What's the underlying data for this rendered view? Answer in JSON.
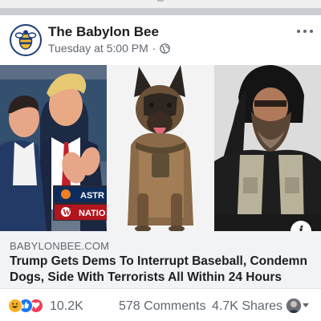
{
  "post": {
    "page_name": "The Babylon Bee",
    "timestamp": "Tuesday at 5:00 PM",
    "privacy_separator": "·",
    "privacy_icon": "globe-icon",
    "menu_icon": "more-options-icon"
  },
  "image": {
    "panels": [
      {
        "description_icon": "photo-politicians-panel",
        "scoreboard": [
          "ASTR",
          "NATIO"
        ]
      },
      {
        "description_icon": "photo-dog-panel"
      },
      {
        "description_icon": "photo-bearded-man-panel"
      }
    ],
    "info_label": "i"
  },
  "link": {
    "domain": "BABYLONBEE.COM",
    "headline": "Trump Gets Dems To Interrupt Baseball, Condemn Dogs, Side With Terrorists All Within 24 Hours"
  },
  "engagement": {
    "reaction_icons": [
      "haha-reaction-icon",
      "like-reaction-icon",
      "love-reaction-icon"
    ],
    "reaction_count": "10.2K",
    "comments": "578 Comments",
    "shares": "4.7K Shares"
  },
  "colors": {
    "like": "#1877f2",
    "love": "#f33e58",
    "haha": "#f7b125",
    "logo_ring": "#1c3f7a",
    "logo_yellow": "#f5b82e"
  }
}
